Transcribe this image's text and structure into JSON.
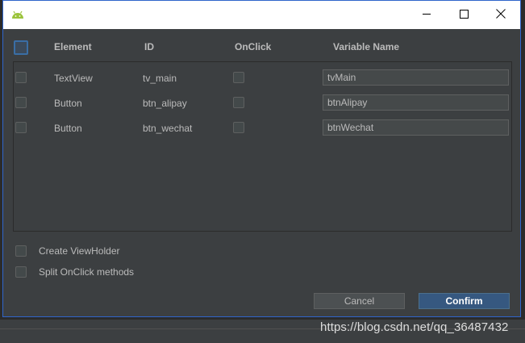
{
  "window": {
    "title": "",
    "app_icon": "android-icon",
    "controls": [
      "minimize-icon",
      "maximize-icon",
      "close-icon"
    ]
  },
  "columns": {
    "element": "Element",
    "id": "ID",
    "onclick": "OnClick",
    "variable_name": "Variable Name"
  },
  "rows": [
    {
      "element": "TextView",
      "id": "tv_main",
      "variable": "tvMain",
      "checked": false,
      "onclick": false
    },
    {
      "element": "Button",
      "id": "btn_alipay",
      "variable": "btnAlipay",
      "checked": false,
      "onclick": false
    },
    {
      "element": "Button",
      "id": "btn_wechat",
      "variable": "btnWechat",
      "checked": false,
      "onclick": false
    }
  ],
  "options": {
    "create_viewholder": "Create ViewHolder",
    "split_onclick": "Split OnClick methods"
  },
  "buttons": {
    "cancel": "Cancel",
    "confirm": "Confirm"
  },
  "watermark": "https://blog.csdn.net/qq_36487432",
  "colors": {
    "dialog_bg": "#3c3f41",
    "accent": "#365880",
    "border_focus": "#2f65ca",
    "text": "#bbbbbb"
  }
}
